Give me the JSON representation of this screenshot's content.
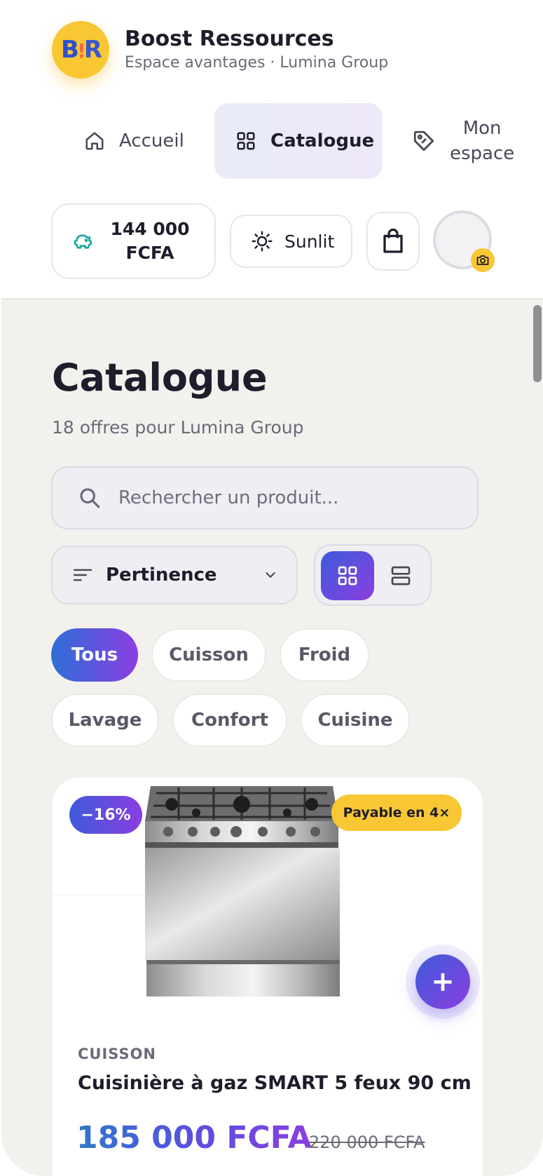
{
  "brand": {
    "title": "Boost Ressources",
    "subtitle": "Espace avantages · Lumina Group",
    "logo_text": "B!R"
  },
  "nav": {
    "home": "Accueil",
    "catalogue": "Catalogue",
    "mon_line1": "Mon",
    "mon_line2": "espace",
    "active": "catalogue"
  },
  "utility": {
    "balance_line1": "144 000",
    "balance_line2": "FCFA",
    "theme_label": "Sunlit"
  },
  "page": {
    "title": "Catalogue",
    "subtitle": "18 offres pour Lumina Group"
  },
  "search": {
    "placeholder": "Rechercher un produit..."
  },
  "sort": {
    "label": "Pertinence"
  },
  "view": {
    "active": "grid"
  },
  "categories": [
    "Tous",
    "Cuisson",
    "Froid",
    "Lavage",
    "Confort",
    "Cuisine"
  ],
  "active_category": "Tous",
  "product": {
    "discount": "−16%",
    "payment_badge": "Payable en 4×",
    "category": "CUISSON",
    "name": "Cuisinière à gaz SMART 5 feux 90 cm",
    "price": "185 000 FCFA",
    "old_price": "220 000 FCFA",
    "add_label": "+"
  },
  "colors": {
    "accent_blue": "#3d5bd9",
    "accent_purple": "#8b3ee0",
    "brand_yellow": "#f8c733",
    "background": "#f3f1ee"
  }
}
